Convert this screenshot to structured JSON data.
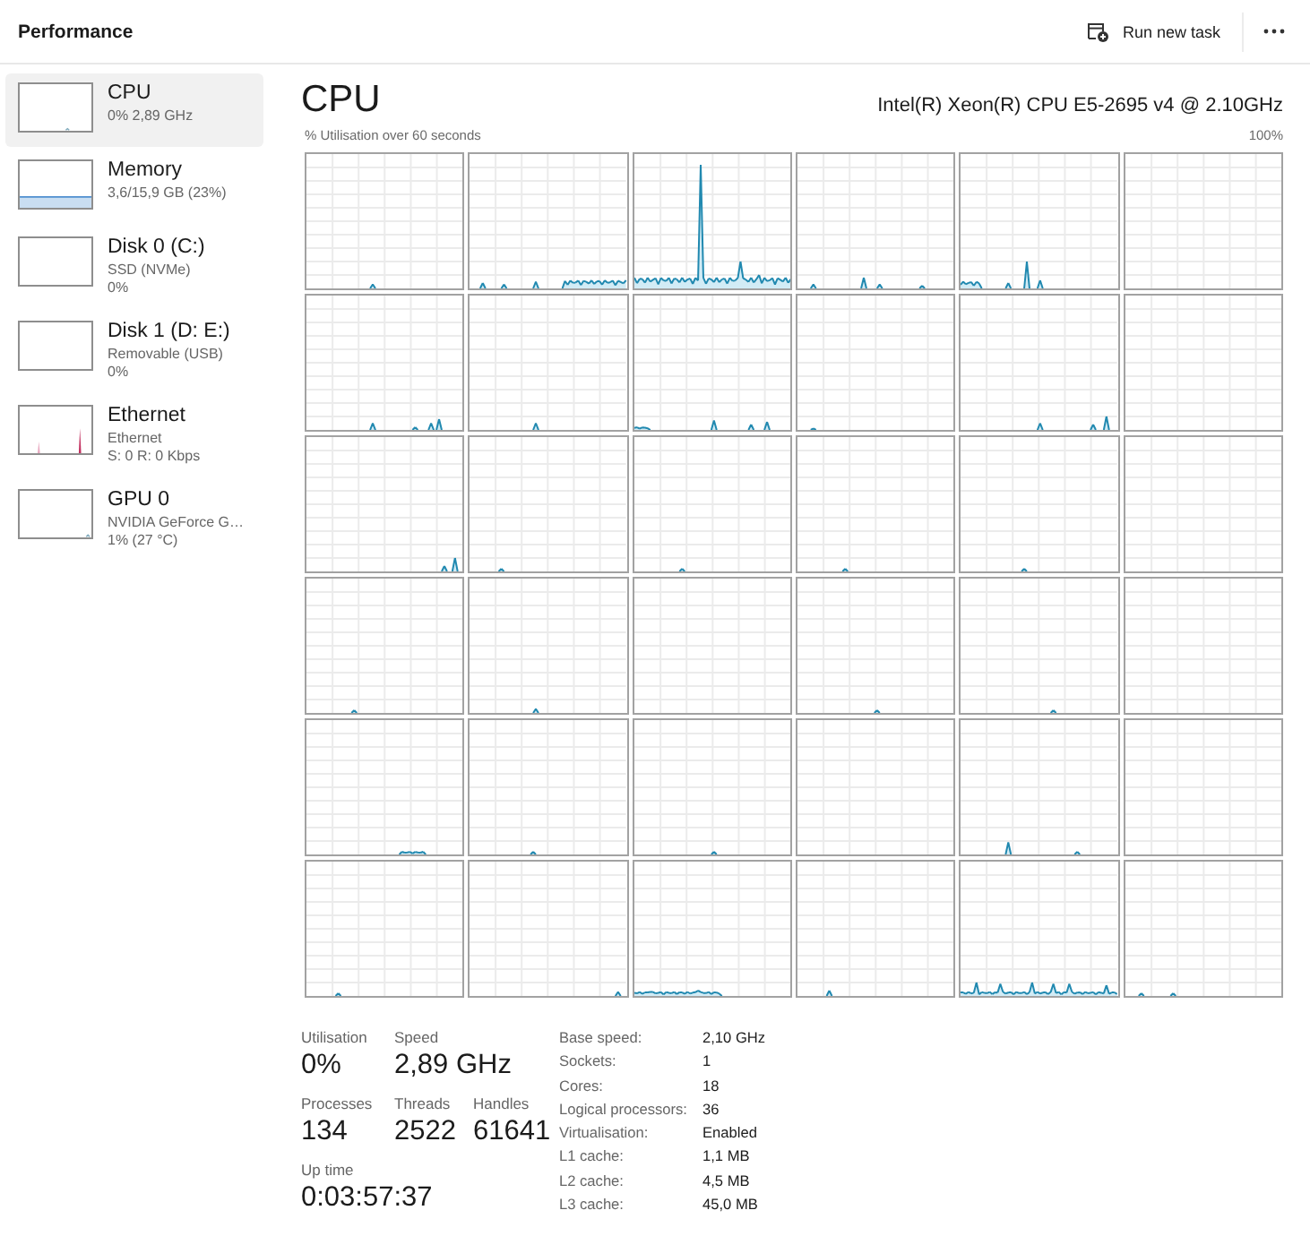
{
  "window": {
    "title": "Performance"
  },
  "toolbar": {
    "buttons": [
      {
        "label": "Run new task"
      }
    ]
  },
  "sidebar": {
    "items": [
      {
        "kind": "cpu",
        "title": "CPU",
        "details": [
          "0% 2,89 GHz"
        ],
        "selected": true
      },
      {
        "kind": "memory",
        "title": "Memory",
        "details": [
          "3,6/15,9 GB (23%)"
        ],
        "selected": false
      },
      {
        "kind": "disk",
        "title": "Disk 0 (C:)",
        "details": [
          "SSD (NVMe)",
          "0%"
        ],
        "selected": false
      },
      {
        "kind": "disk",
        "title": "Disk 1 (D: E:)",
        "details": [
          "Removable (USB)",
          "0%"
        ],
        "selected": false
      },
      {
        "kind": "ethernet",
        "title": "Ethernet",
        "details": [
          "Ethernet",
          "S: 0 R: 0 Kbps"
        ],
        "selected": false
      },
      {
        "kind": "gpu",
        "title": "GPU 0",
        "details": [
          "NVIDIA GeForce G…",
          "1% (27 °C)"
        ],
        "selected": false
      }
    ]
  },
  "detail": {
    "title": "CPU",
    "model": "Intel(R) Xeon(R) CPU E5-2695 v4 @ 2.10GHz",
    "graph_caption": "% Utilisation over 60 seconds",
    "graph_max": "100%",
    "stats": [
      {
        "items": [
          {
            "label": "Utilisation",
            "value": "0%"
          },
          {
            "label": "Speed",
            "value": "2,89 GHz"
          }
        ]
      },
      {
        "items": [
          {
            "label": "Processes",
            "value": "134"
          },
          {
            "label": "Threads",
            "value": "2522"
          },
          {
            "label": "Handles",
            "value": "61641"
          }
        ]
      },
      {
        "items": [
          {
            "label": "Up time",
            "value": "0:03:57:37"
          }
        ]
      }
    ],
    "specs": [
      {
        "label": "Base speed:",
        "value": "2,10 GHz"
      },
      {
        "label": "Sockets:",
        "value": "1"
      },
      {
        "label": "Cores:",
        "value": "18"
      },
      {
        "label": "Logical processors:",
        "value": "36"
      },
      {
        "label": "Virtualisation:",
        "value": "Enabled"
      },
      {
        "label": "L1 cache:",
        "value": "1,1 MB"
      },
      {
        "label": "L2 cache:",
        "value": "4,5 MB"
      },
      {
        "label": "L3 cache:",
        "value": "45,0 MB"
      }
    ]
  }
}
